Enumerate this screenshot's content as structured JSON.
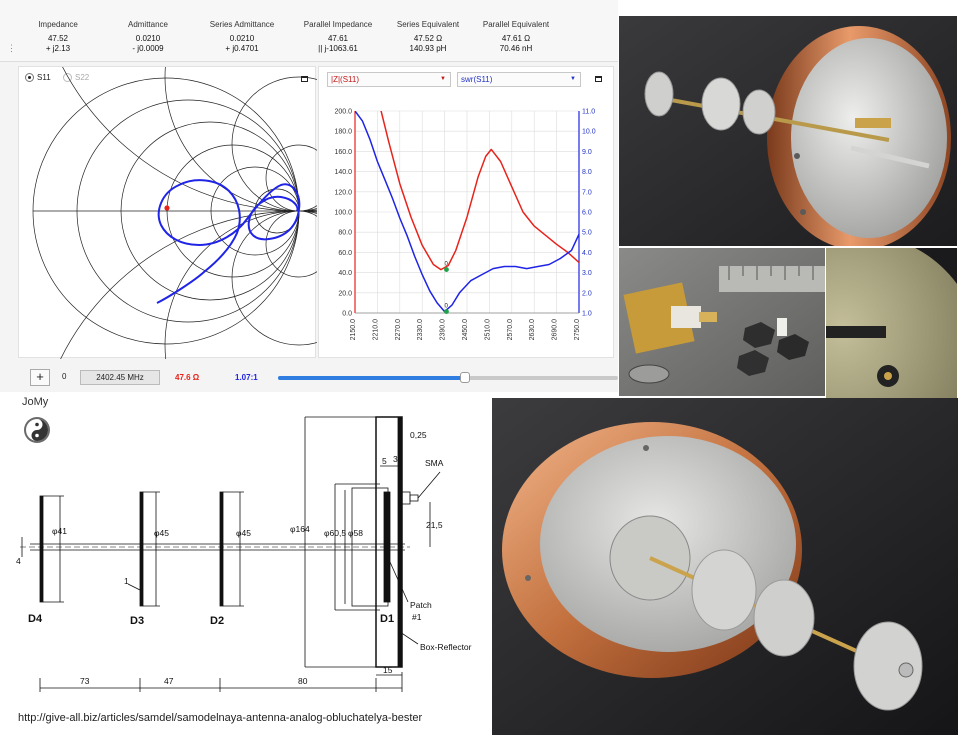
{
  "header": {
    "columns": [
      {
        "title": "Impedance",
        "line1": "47.52",
        "line2": "+ j2.13"
      },
      {
        "title": "Admittance",
        "line1": "0.0210",
        "line2": "- j0.0009"
      },
      {
        "title": "Series Admittance",
        "line1": "0.0210",
        "line2": "+ j0.4701"
      },
      {
        "title": "Parallel Impedance",
        "line1": "47.61",
        "line2": "|| j-1063.61"
      },
      {
        "title": "Series Equivalent",
        "line1": "47.52 Ω",
        "line2": "140.93 pH"
      },
      {
        "title": "Parallel Equivalent",
        "line1": "47.61 Ω",
        "line2": "70.46 nH"
      }
    ]
  },
  "smith": {
    "option_s11": "S11",
    "option_s22": "S22",
    "selected": "S11"
  },
  "plot": {
    "left_select": "|Z|(S11)",
    "right_select": "swr(S11)"
  },
  "chart_data": {
    "type": "line",
    "xlim": [
      2150,
      2750
    ],
    "x_ticks": [
      "2150.0",
      "2210.0",
      "2270.0",
      "2330.0",
      "2390.0",
      "2450.0",
      "2510.0",
      "2570.0",
      "2630.0",
      "2690.0",
      "2750.0"
    ],
    "y_left_ticks": [
      "200.0",
      "180.0",
      "160.0",
      "140.0",
      "120.0",
      "100.0",
      "80.0",
      "60.0",
      "40.0",
      "20.0",
      "0.0"
    ],
    "y_right_ticks": [
      "11.0",
      "10.0",
      "9.0",
      "8.0",
      "7.0",
      "6.0",
      "5.0",
      "4.0",
      "3.0",
      "2.0",
      "1.0"
    ],
    "ylim_left": [
      0,
      200
    ],
    "ylim_right": [
      1,
      11
    ],
    "grid": true,
    "series": [
      {
        "axis": "left",
        "color": "#e8231b",
        "x": [
          2150,
          2220,
          2240,
          2270,
          2300,
          2330,
          2360,
          2380,
          2400,
          2420,
          2450,
          2480,
          2500,
          2515,
          2540,
          2570,
          2600,
          2630,
          2660,
          2690,
          2720,
          2750
        ],
        "y": [
          280,
          200,
          170,
          128,
          95,
          67,
          48,
          43,
          47,
          62,
          95,
          135,
          155,
          162,
          150,
          125,
          100,
          86,
          77,
          68,
          60,
          50
        ]
      },
      {
        "axis": "right",
        "color": "#1f24e6",
        "x": [
          2150,
          2170,
          2190,
          2210,
          2230,
          2250,
          2270,
          2290,
          2310,
          2330,
          2350,
          2370,
          2390,
          2410,
          2430,
          2460,
          2490,
          2520,
          2550,
          2580,
          2610,
          2640,
          2670,
          2700,
          2730,
          2750
        ],
        "y": [
          11.0,
          10.5,
          9.6,
          8.5,
          7.6,
          6.7,
          5.7,
          4.8,
          3.8,
          2.9,
          2.1,
          1.5,
          1.07,
          1.4,
          2.0,
          2.6,
          2.9,
          3.2,
          3.3,
          3.3,
          3.2,
          3.3,
          3.4,
          3.7,
          4.1,
          4.9
        ]
      }
    ],
    "markers": [
      {
        "label": "0",
        "x": 2395,
        "y_axis": "left",
        "y": 43,
        "color": "#1fa34a"
      },
      {
        "label": "0",
        "x": 2395,
        "y_axis": "right",
        "y": 1.07,
        "color": "#1fa34a"
      }
    ]
  },
  "bottom": {
    "plus_label": "+",
    "marker_index": "0",
    "frequency": "2402.45 MHz",
    "impedance": "47.6 Ω",
    "swr": "1.07:1",
    "slider_position": 0.55
  },
  "drawing": {
    "brand": "JoMy",
    "labels": {
      "d4": "D4",
      "d3": "D3",
      "d2": "D2",
      "d1": "D1",
      "phi41": "φ41",
      "phi45a": "φ45",
      "phi45b": "φ45",
      "phi164": "φ164",
      "phi60": "φ60,5",
      "phi58": "φ58",
      "dim025": "0,25",
      "dim5": "5",
      "dim3": "3",
      "sma": "SMA",
      "dim215": "21,5",
      "dim4": "4",
      "dim1": "1",
      "patch": "Patch",
      "patch_no": "#1",
      "box": "Box-Reflector",
      "dim73": "73",
      "dim47": "47",
      "dim80": "80",
      "dim15": "15"
    }
  },
  "url": "http://give-all.biz/articles/samdel/samodelnaya-antenna-analog-obluchatelya-bester",
  "colors": {
    "accent_blue": "#1f24e6",
    "accent_red": "#e8231b",
    "marker_green": "#1fa34a",
    "slider_blue": "#2f7de1"
  }
}
